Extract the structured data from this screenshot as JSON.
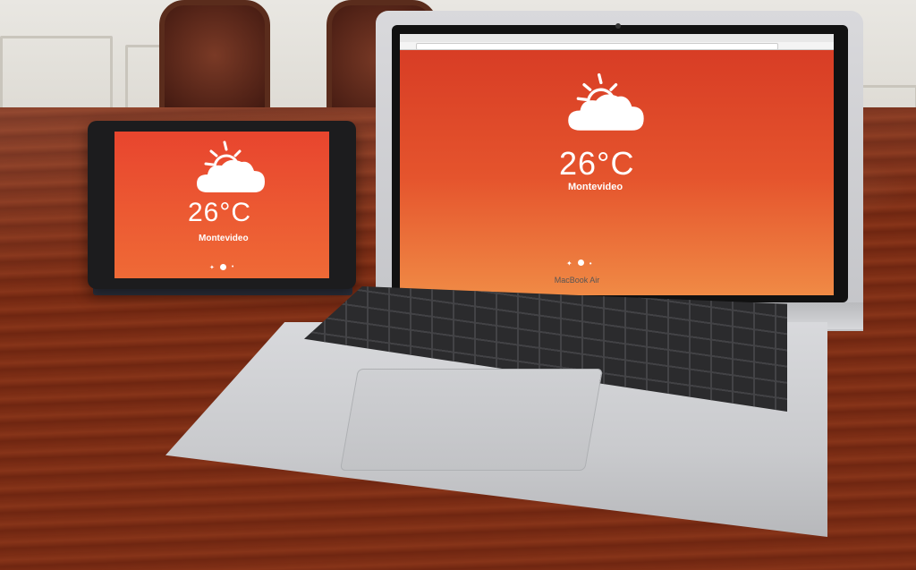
{
  "scene": {
    "laptop_model": "MacBook Air"
  },
  "weather_app": {
    "temperature": "26°C",
    "city": "Montevideo",
    "icon": "sun-behind-cloud-icon",
    "social_icons": [
      "twitter-icon",
      "circle-icon",
      "small-circle-icon"
    ]
  },
  "colors": {
    "screen_top": "#d63a24",
    "screen_bottom": "#f08a45",
    "ipad_top": "#e8452e",
    "ipad_bottom": "#ef6a36"
  }
}
